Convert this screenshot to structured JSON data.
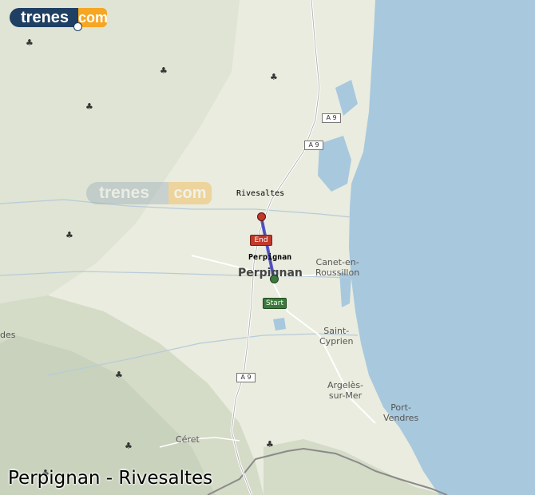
{
  "logo": {
    "left_text": "trenes",
    "right_text": "com"
  },
  "watermark": {
    "left_text": "trenes",
    "right_text": "com"
  },
  "route": {
    "title": "Perpignan - Rivesaltes",
    "origin": "Perpignan",
    "destination": "Rivesaltes",
    "start_label": "Start",
    "end_label": "End",
    "start_color": "#3c7a3c",
    "end_color": "#c0392b",
    "line_color": "#5b5bd6"
  },
  "map_labels": {
    "perpignan_city": "Perpignan",
    "canet": [
      "Canet-en-",
      "Roussillon"
    ],
    "saint_cyprien": [
      "Saint-",
      "Cyprien"
    ],
    "argeles": [
      "Argelès-",
      "sur-Mer"
    ],
    "port_vendres": [
      "Port-",
      "Vendres"
    ],
    "ceret": "Céret",
    "edge_des": "des"
  },
  "roads": [
    "A 9",
    "A 9",
    "A 9"
  ],
  "colors": {
    "sea": "#a8c8de",
    "land": "#e9ecde",
    "relief": "#cfd7c3",
    "road": "#ffffff"
  }
}
